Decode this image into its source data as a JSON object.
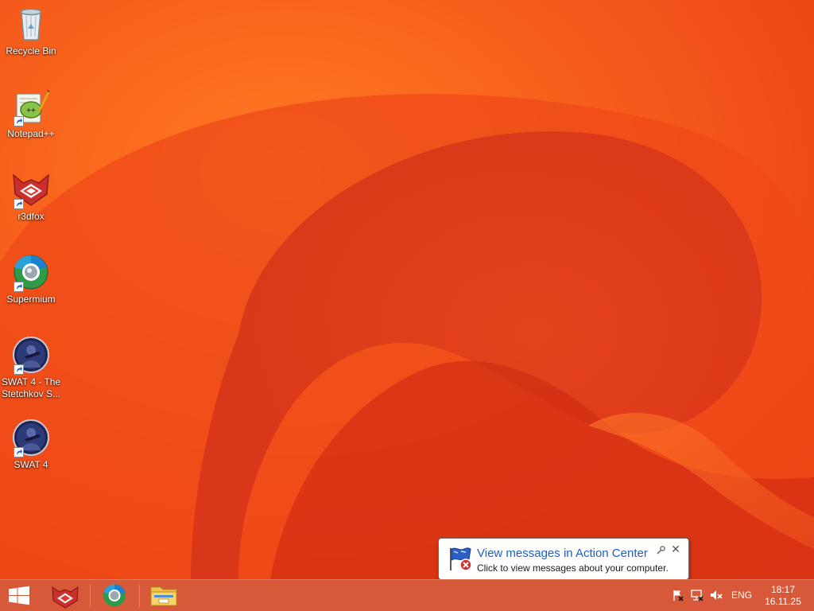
{
  "desktop": {
    "wallpaper_colors": [
      "#f24e12",
      "#e03d18",
      "#d42f17",
      "#ff8a2a"
    ],
    "icons": [
      {
        "label": "Recycle Bin",
        "icon": "recycle-bin-icon",
        "shortcut": false
      },
      {
        "label": "Notepad++",
        "icon": "notepad-plus-plus-icon",
        "shortcut": true
      },
      {
        "label": "r3dfox",
        "icon": "r3dfox-icon",
        "shortcut": true
      },
      {
        "label": "Supermium",
        "icon": "supermium-icon",
        "shortcut": true
      },
      {
        "label": "SWAT 4 - The\nStetchkov S...",
        "icon": "swat4-stetchkov-icon",
        "shortcut": true
      },
      {
        "label": "SWAT 4",
        "icon": "swat4-icon",
        "shortcut": true
      }
    ]
  },
  "taskbar": {
    "color": "#d8583a",
    "start_icon": "windows-start-icon",
    "pinned": [
      {
        "name": "r3dfox",
        "icon": "r3dfox-icon"
      },
      {
        "name": "Supermium",
        "icon": "supermium-icon"
      },
      {
        "name": "File Explorer",
        "icon": "file-explorer-icon"
      }
    ],
    "tray": {
      "icons": [
        "action-center-flag-icon",
        "network-icon",
        "volume-muted-icon"
      ],
      "language": "ENG",
      "time": "18:17",
      "date": "16.11.25"
    }
  },
  "notification": {
    "title": "View messages in Action Center",
    "text": "Click to view messages about your computer.",
    "icon": "action-center-flag-error-icon",
    "title_color": "#1c5fc7"
  }
}
